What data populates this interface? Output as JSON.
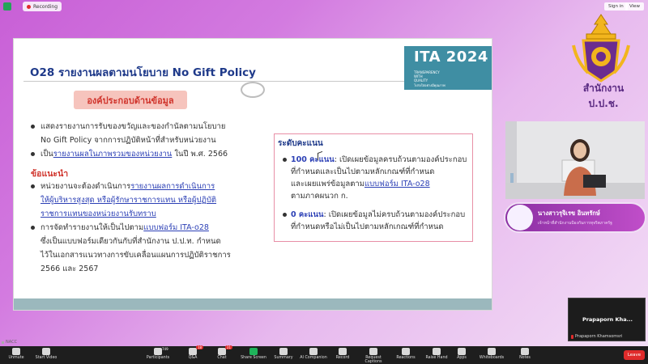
{
  "topbar": {
    "recording_label": "Recording",
    "sign_in_label": "Sign in",
    "view_label": "View"
  },
  "slide": {
    "title": "O28 รายงานผลตามนโยบาย No Gift Policy",
    "ita_badge": {
      "title": "ITA 2024",
      "subtitle_line1": "TRANSPARENCY",
      "subtitle_line2": "WITH",
      "subtitle_line3": "QUALITY",
      "subtitle_line4": "โปร่งใสอย่างมีคุณภาพ"
    },
    "section_pill": "องค์ประกอบด้านข้อมูล",
    "bullets": [
      {
        "line1": "แสดงรายงานการรับของขวัญและของกำนัลตามนโยบาย",
        "line2": "No Gift Policy จากการปฏิบัติหน้าที่สำหรับหน่วยงาน"
      },
      {
        "pre": "เป็น",
        "hi": "รายงานผลในภาพรวมของหน่วยงาน",
        "post": " ในปี พ.ศ. 2566"
      }
    ],
    "recommend_heading": "ข้อแนะนำ",
    "recommend": [
      {
        "pre": "หน่วยงานจะต้องดำเนินการ",
        "hi1": "รายงานผลการดำเนินการ",
        "hi2": "ให้ผู้บริหารสูงสุด หรือผู้รักษาราชการแทน หรือผู้ปฏิบัติ",
        "hi3": "ราชการแทนของหน่วยงานรับทราบ"
      },
      {
        "pre": "การจัดทำรายงานให้เป็นไปตาม",
        "hi": "แบบฟอร์ม ITA-o28",
        "line2": "ซึ่งเป็นแบบฟอร์มเดียวกันกับที่สำนักงาน ป.ป.ท. กำหนด",
        "line3": "ไว้ในเอกสารแนวทางการขับเคลื่อนแผนการปฏิบัติราชการ",
        "line4": "2566 และ 2567"
      }
    ],
    "score": {
      "title": "ระดับคะแนน",
      "full": {
        "points": "100 คะแนน",
        "l1": ": เปิดเผยข้อมูลครบถ้วนตามองค์ประกอบ",
        "l2": "ที่กำหนดและเป็นไปตามหลักเกณฑ์ที่กำหนด",
        "l3pre": "และเผยแพร่ข้อมูลตาม",
        "l3hi": "แบบฟอร์ม ITA-o28",
        "l4": "ตามภาคผนวก ก."
      },
      "zero": {
        "points": "0 คะแนน",
        "l1": ": เปิดเผยข้อมูลไม่ครบถ้วนตามองค์ประกอบ",
        "l2": "ที่กำหนดหรือไม่เป็นไปตามหลักเกณฑ์ที่กำหนด"
      }
    }
  },
  "right_panel": {
    "emblem_text": "สำนักงาน ป.ป.ช.",
    "name_card_line1": "นางสาวรุจิเรข อินทรักษ์",
    "name_card_line2": "เจ้าหน้าที่สำนักงานป้องกันการทุจริตภาครัฐ"
  },
  "participant_tile": {
    "display_name": "Prapaporn  Kha...",
    "label": "Prapaporn Khamsomsri"
  },
  "meeting": {
    "host_label": "NACC"
  },
  "bottombar": {
    "items": [
      {
        "label": "Unmute",
        "icon": "mic-off-icon"
      },
      {
        "label": "Start Video",
        "icon": "video-off-icon"
      },
      {
        "label": "Participants",
        "icon": "participants-icon",
        "count": "749"
      },
      {
        "label": "Q&A",
        "icon": "qa-icon",
        "badge": "18"
      },
      {
        "label": "Chat",
        "icon": "chat-icon",
        "badge": "21"
      },
      {
        "label": "Share Screen",
        "icon": "share-screen-icon"
      },
      {
        "label": "Summary",
        "icon": "summary-icon"
      },
      {
        "label": "AI Companion",
        "icon": "ai-companion-icon"
      },
      {
        "label": "Record",
        "icon": "record-icon"
      },
      {
        "label": "Request Captions",
        "icon": "captions-icon"
      },
      {
        "label": "Reactions",
        "icon": "reactions-icon"
      },
      {
        "label": "Raise Hand",
        "icon": "raise-hand-icon"
      },
      {
        "label": "Apps",
        "icon": "apps-icon"
      },
      {
        "label": "Whiteboards",
        "icon": "whiteboards-icon"
      },
      {
        "label": "Notes",
        "icon": "notes-icon"
      }
    ],
    "leave_label": "Leave"
  },
  "colors": {
    "title_blue": "#1f3a8a",
    "accent_red": "#d0342c",
    "highlight_blue": "#2b3fb5",
    "ita_teal": "#3f8ea3",
    "leave_red": "#e02b2b"
  }
}
